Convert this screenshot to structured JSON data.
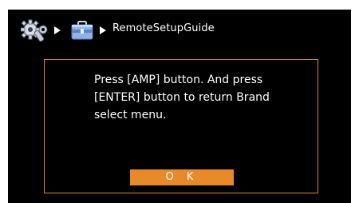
{
  "header": {
    "settings_icon": "gear-wrench-icon",
    "category_icon": "toolbox-icon",
    "breadcrumb_label": "RemoteSetupGuide"
  },
  "dialog": {
    "message": "Press [AMP] button. And press [ENTER] button to return Brand select menu.",
    "ok_label": "O K"
  },
  "colors": {
    "accent": "#e88a2a",
    "background": "#000000",
    "text": "#ffffff"
  }
}
